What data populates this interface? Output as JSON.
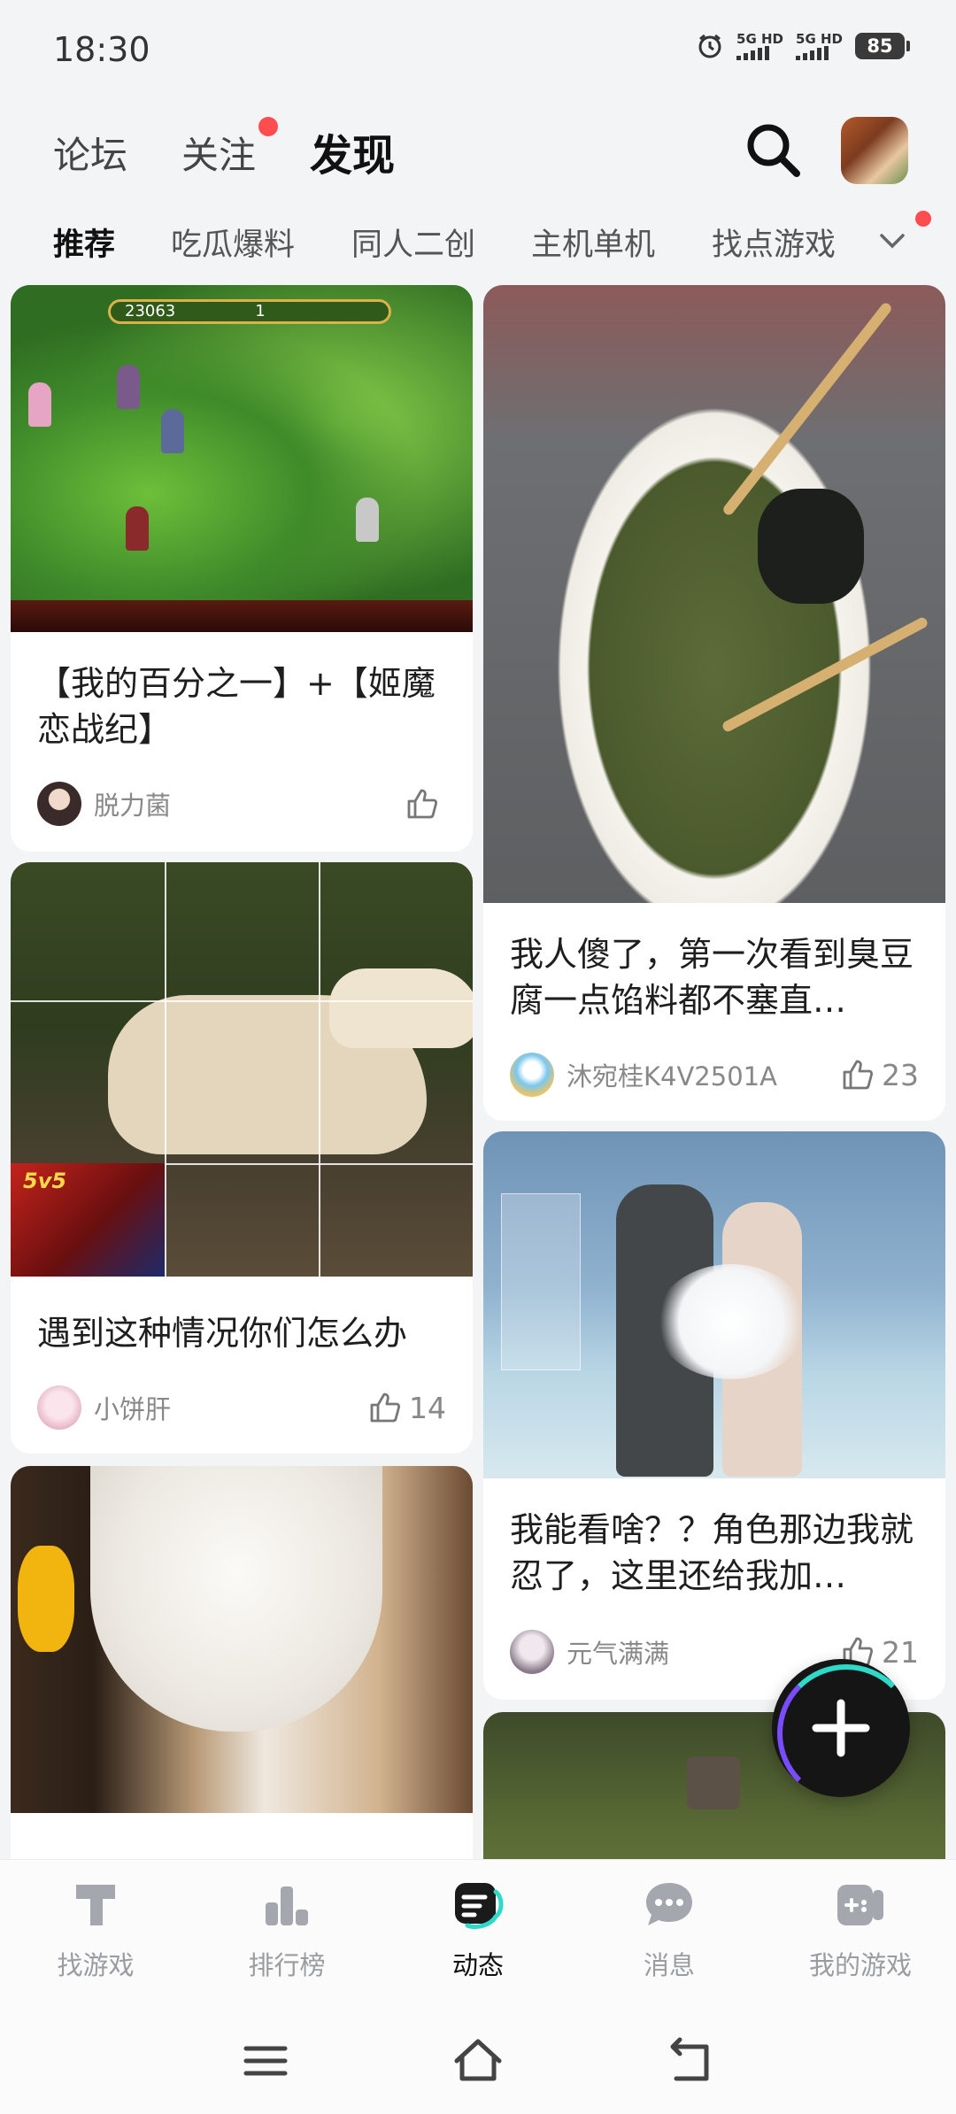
{
  "status": {
    "time": "18:30",
    "net1": "5G HD",
    "net2": "5G HD",
    "battery": "85"
  },
  "top_nav": {
    "tabs": [
      "论坛",
      "关注",
      "发现"
    ],
    "active": "发现"
  },
  "categories": {
    "items": [
      "推荐",
      "吃瓜爆料",
      "同人二创",
      "主机单机",
      "找点游戏"
    ],
    "active": "推荐"
  },
  "game_hud": {
    "score": "23063",
    "level": "1"
  },
  "dog_badge": "5v5",
  "posts": [
    {
      "title": "【我的百分之一】+【姬魔恋战纪】",
      "author": "脱力菌",
      "likes": ""
    },
    {
      "title": "我人傻了，第一次看到臭豆腐一点馅料都不塞直…",
      "author": "沐宛桂K4V2501A",
      "likes": "23"
    },
    {
      "title": "遇到这种情况你们怎么办",
      "author": "小饼肝",
      "likes": "14"
    },
    {
      "title": "我能看啥？？角色那边我就忍了，这里还给我加…",
      "author": "元气满满",
      "likes": "21"
    }
  ],
  "bottom_nav": {
    "items": [
      "找游戏",
      "排行榜",
      "动态",
      "消息",
      "我的游戏"
    ],
    "active": "动态"
  },
  "colors": {
    "accent": "#2fd9c8",
    "badge": "#ff4d4f"
  }
}
